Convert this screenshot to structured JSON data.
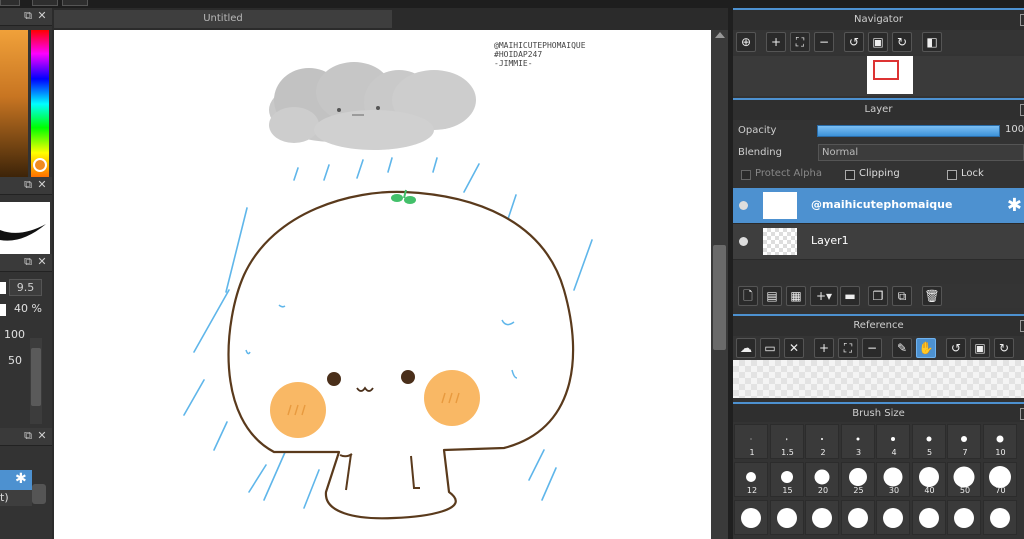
{
  "document": {
    "tab_title": "Untitled"
  },
  "left_panel": {
    "brush_size_value": "9.5",
    "opacity_value": "40 %",
    "scale_top": "100",
    "scale_mid": "50",
    "layer_label_fragment": "t)"
  },
  "canvas": {
    "watermark_lines": [
      "@MAIHICUTEPHOMAIQUE",
      "#HOIDAP247",
      "-JIMMIE-"
    ]
  },
  "navigator": {
    "title": "Navigator"
  },
  "layer_panel": {
    "title": "Layer",
    "opacity_label": "Opacity",
    "opacity_value": "100",
    "opacity_fraction": 1.0,
    "blending_label": "Blending",
    "blending_value": "Normal",
    "protect_alpha": "Protect Alpha",
    "clipping": "Clipping",
    "lock": "Lock",
    "layers": [
      {
        "name": "@maihicutephomaique",
        "selected": true
      },
      {
        "name": "Layer1",
        "selected": false
      }
    ]
  },
  "reference": {
    "title": "Reference"
  },
  "brush_size": {
    "title": "Brush Size",
    "rows": [
      [
        {
          "label": "1",
          "d": 1
        },
        {
          "label": "1.5",
          "d": 1.5
        },
        {
          "label": "2",
          "d": 2
        },
        {
          "label": "3",
          "d": 3
        },
        {
          "label": "4",
          "d": 4
        },
        {
          "label": "5",
          "d": 5
        },
        {
          "label": "7",
          "d": 6
        },
        {
          "label": "10",
          "d": 7
        }
      ],
      [
        {
          "label": "12",
          "d": 10
        },
        {
          "label": "15",
          "d": 12
        },
        {
          "label": "20",
          "d": 15
        },
        {
          "label": "25",
          "d": 18
        },
        {
          "label": "30",
          "d": 19
        },
        {
          "label": "40",
          "d": 20
        },
        {
          "label": "50",
          "d": 21
        },
        {
          "label": "70",
          "d": 22
        }
      ],
      [
        {
          "label": "",
          "d": 20
        },
        {
          "label": "",
          "d": 20
        },
        {
          "label": "",
          "d": 20
        },
        {
          "label": "",
          "d": 20
        },
        {
          "label": "",
          "d": 20
        },
        {
          "label": "",
          "d": 20
        },
        {
          "label": "",
          "d": 20
        },
        {
          "label": "",
          "d": 20
        }
      ]
    ]
  },
  "colors": {
    "accent": "#4d91d0",
    "outline": "#5a3a1c",
    "blush": "#f9b865",
    "rain": "#5fb6ea",
    "cloud": "#c8c8c8"
  }
}
